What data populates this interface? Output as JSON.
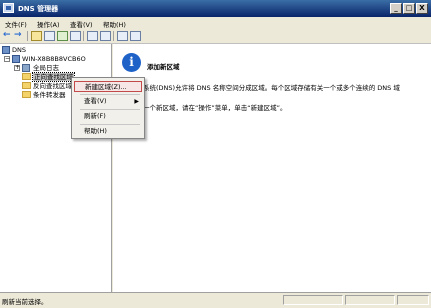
{
  "window": {
    "title": "DNS 管理器",
    "controls": [
      "_",
      "□",
      "X"
    ]
  },
  "menubar": {
    "items": [
      "文件(F)",
      "操作(A)",
      "查看(V)",
      "帮助(H)"
    ]
  },
  "toolbar": {
    "icons": [
      "back-icon",
      "forward-icon",
      "up-folder-icon",
      "show-hide-tree-icon",
      "refresh-icon",
      "export-icon",
      "help-icon",
      "properties-icon",
      "server-icon",
      "zone-icon"
    ]
  },
  "tree": {
    "root": "DNS",
    "server": "WIN-X8B8B8VCB6O",
    "global_logs": "全局日志",
    "forward_zone": "正向查找区域",
    "reverse_zone": "反向查找区域",
    "conditional_forwarders": "条件转发器"
  },
  "content": {
    "heading": "添加新区域",
    "paragraph1": "系统(DNS)允许将 DNS 名称空间分成区域。每个区域存储有关一个或多个连续的 DNS 域",
    "paragraph2": "一个新区域，请在“操作”菜单，单击“新建区域”。"
  },
  "context_menu": {
    "items": [
      {
        "label": "新建区域(Z)...",
        "highlighted": true
      },
      {
        "label": "查看(V)",
        "submenu": true
      },
      {
        "label": "刷新(F)"
      },
      {
        "label": "帮助(H)"
      }
    ],
    "submenu_arrow": "▶"
  },
  "statusbar": {
    "text": "刷新当前选择。"
  },
  "colors": {
    "title_bar": "#0a246a",
    "info_icon": "#1e62c8",
    "highlight_border": "#c24a4a"
  }
}
